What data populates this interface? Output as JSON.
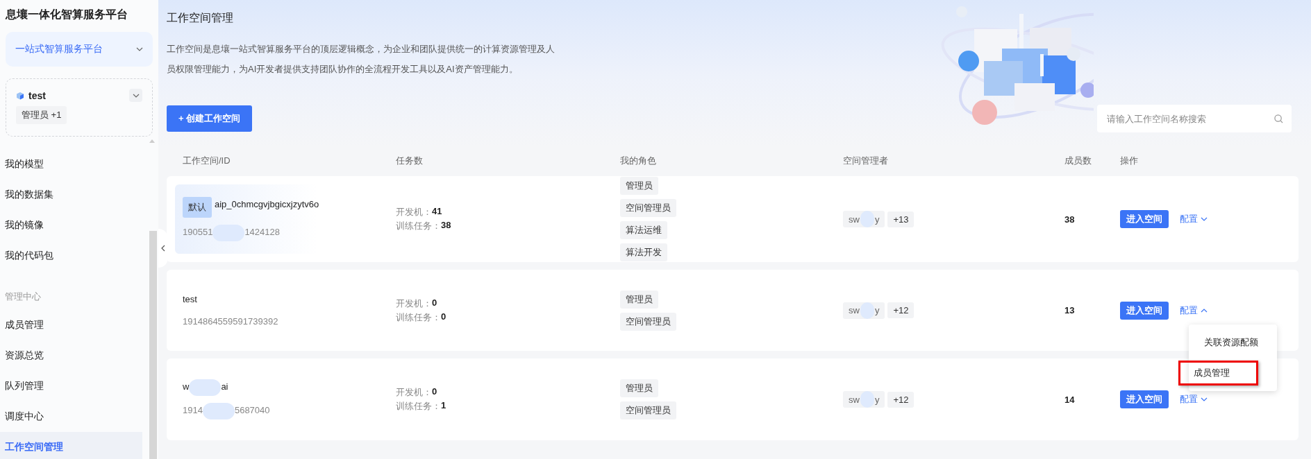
{
  "sidebar": {
    "title": "息壤一体化智算服务平台",
    "platform_select": {
      "value": "一站式智算服务平台"
    },
    "workspace": {
      "name": "test",
      "role": "管理员 +1"
    },
    "items": [
      {
        "kind": "item",
        "label": "我的模型",
        "selected": false
      },
      {
        "kind": "item",
        "label": "我的数据集",
        "selected": false
      },
      {
        "kind": "item",
        "label": "我的镜像",
        "selected": false
      },
      {
        "kind": "item",
        "label": "我的代码包",
        "selected": false
      },
      {
        "kind": "group",
        "label": "管理中心"
      },
      {
        "kind": "item",
        "label": "成员管理",
        "selected": false
      },
      {
        "kind": "item",
        "label": "资源总览",
        "selected": false
      },
      {
        "kind": "item",
        "label": "队列管理",
        "selected": false
      },
      {
        "kind": "item",
        "label": "调度中心",
        "selected": false
      },
      {
        "kind": "item",
        "label": "工作空间管理",
        "selected": true
      }
    ]
  },
  "page": {
    "title": "工作空间管理",
    "description": "工作空间是息壤一站式智算服务平台的顶层逻辑概念，为企业和团队提供统一的计算资源管理及人员权限管理能力，为AI开发者提供支持团队协作的全流程开发工具以及AI资产管理能力。",
    "create_button": "+ 创建工作空间",
    "search": {
      "placeholder": "请输入工作空间名称搜索"
    }
  },
  "table": {
    "columns": [
      "工作空间/ID",
      "任务数",
      "我的角色",
      "空间管理者",
      "成员数",
      "操作"
    ],
    "rows": [
      {
        "default_tag": "默认",
        "name_parts": [
          "aip_0chmcgvjbgicxjzytv6o"
        ],
        "id_parts": [
          "190551",
          "1424128"
        ],
        "dev_label": "开发机：",
        "dev": "41",
        "train_label": "训练任务：",
        "train": "38",
        "roles": [
          "管理员",
          "空间管理员",
          "算法运维",
          "算法开发"
        ],
        "manager_parts": [
          "sw",
          "y"
        ],
        "manager_more": "+13",
        "members": "38",
        "enter": "进入空间",
        "config": "配置",
        "expanded": false
      },
      {
        "name_parts": [
          "test"
        ],
        "id_parts": [
          "1914864559591739392"
        ],
        "dev_label": "开发机：",
        "dev": "0",
        "train_label": "训练任务：",
        "train": "0",
        "roles": [
          "管理员",
          "空间管理员"
        ],
        "manager_parts": [
          "sw",
          "y"
        ],
        "manager_more": "+12",
        "members": "13",
        "enter": "进入空间",
        "config": "配置",
        "expanded": true,
        "menu": [
          {
            "label": "关联资源配额",
            "highlighted": false
          },
          {
            "label": "成员管理",
            "highlighted": true
          }
        ]
      },
      {
        "name_parts": [
          "w",
          "ai"
        ],
        "id_parts": [
          "1914",
          "5687040"
        ],
        "dev_label": "开发机：",
        "dev": "0",
        "train_label": "训练任务：",
        "train": "1",
        "roles": [
          "管理员",
          "空间管理员"
        ],
        "manager_parts": [
          "sw",
          "y"
        ],
        "manager_more": "+12",
        "members": "14",
        "enter": "进入空间",
        "config": "配置",
        "expanded": false
      }
    ]
  }
}
